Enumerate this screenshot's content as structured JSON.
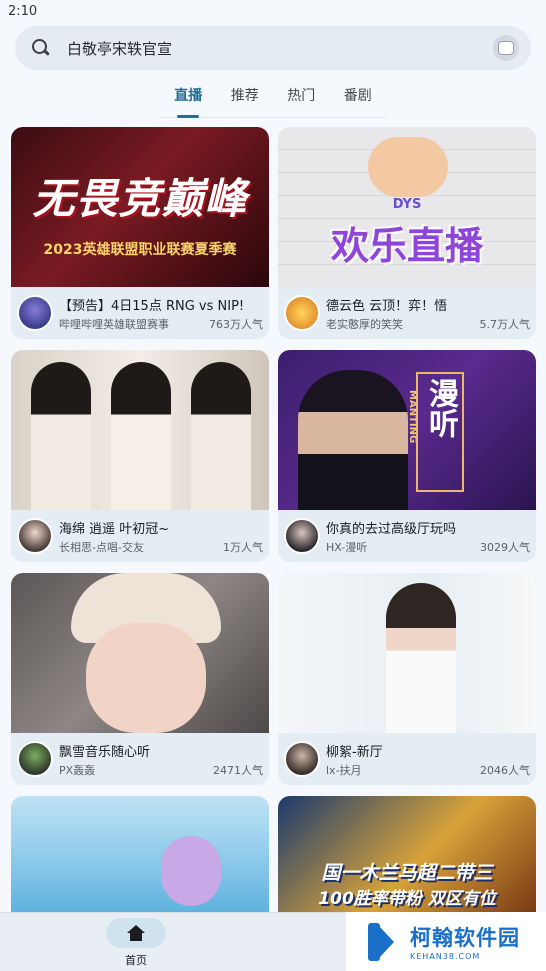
{
  "status_bar": {
    "time": "2:10"
  },
  "search": {
    "query": "白敬亭宋轶官宣"
  },
  "tabs": [
    {
      "label": "直播",
      "active": true
    },
    {
      "label": "推荐",
      "active": false
    },
    {
      "label": "热门",
      "active": false
    },
    {
      "label": "番剧",
      "active": false
    }
  ],
  "cards": [
    {
      "title": "【预告】4日15点  RNG vs NIP!",
      "streamer": "哔哩哔哩英雄联盟赛事",
      "viewers": "763万人气",
      "thumb_text": "无畏竞巅峰",
      "thumb_sub": "2023英雄联盟职业联赛夏季赛"
    },
    {
      "title": "德云色  云顶！弈！悟",
      "streamer": "老实憨厚的笑笑",
      "viewers": "5.7万人气",
      "thumb_text": "欢乐直播",
      "thumb_sub": "DYS"
    },
    {
      "title": "海绵 逍遥 叶初冠~",
      "streamer": "长相思-点唱-交友",
      "viewers": "1万人气"
    },
    {
      "title": "你真的去过高级厅玩吗",
      "streamer": "HX-漫听",
      "viewers": "3029人气",
      "thumb_text": "漫听",
      "thumb_sub": "MANTING"
    },
    {
      "title": "飘雪音乐随心听",
      "streamer": "PX轰轰",
      "viewers": "2471人气"
    },
    {
      "title": "柳絮-新厅",
      "streamer": "lx-扶月",
      "viewers": "2046人气"
    },
    {
      "title": "",
      "streamer": "",
      "viewers": ""
    },
    {
      "title": "",
      "streamer": "",
      "viewers": "",
      "thumb_text": "国一木兰马超二带三",
      "thumb_sub": "100胜率带粉 双区有位"
    }
  ],
  "bottom_nav": {
    "home_label": "首页"
  },
  "watermark": {
    "cn": "柯翰软件园",
    "en": "KEHAN38.COM"
  }
}
